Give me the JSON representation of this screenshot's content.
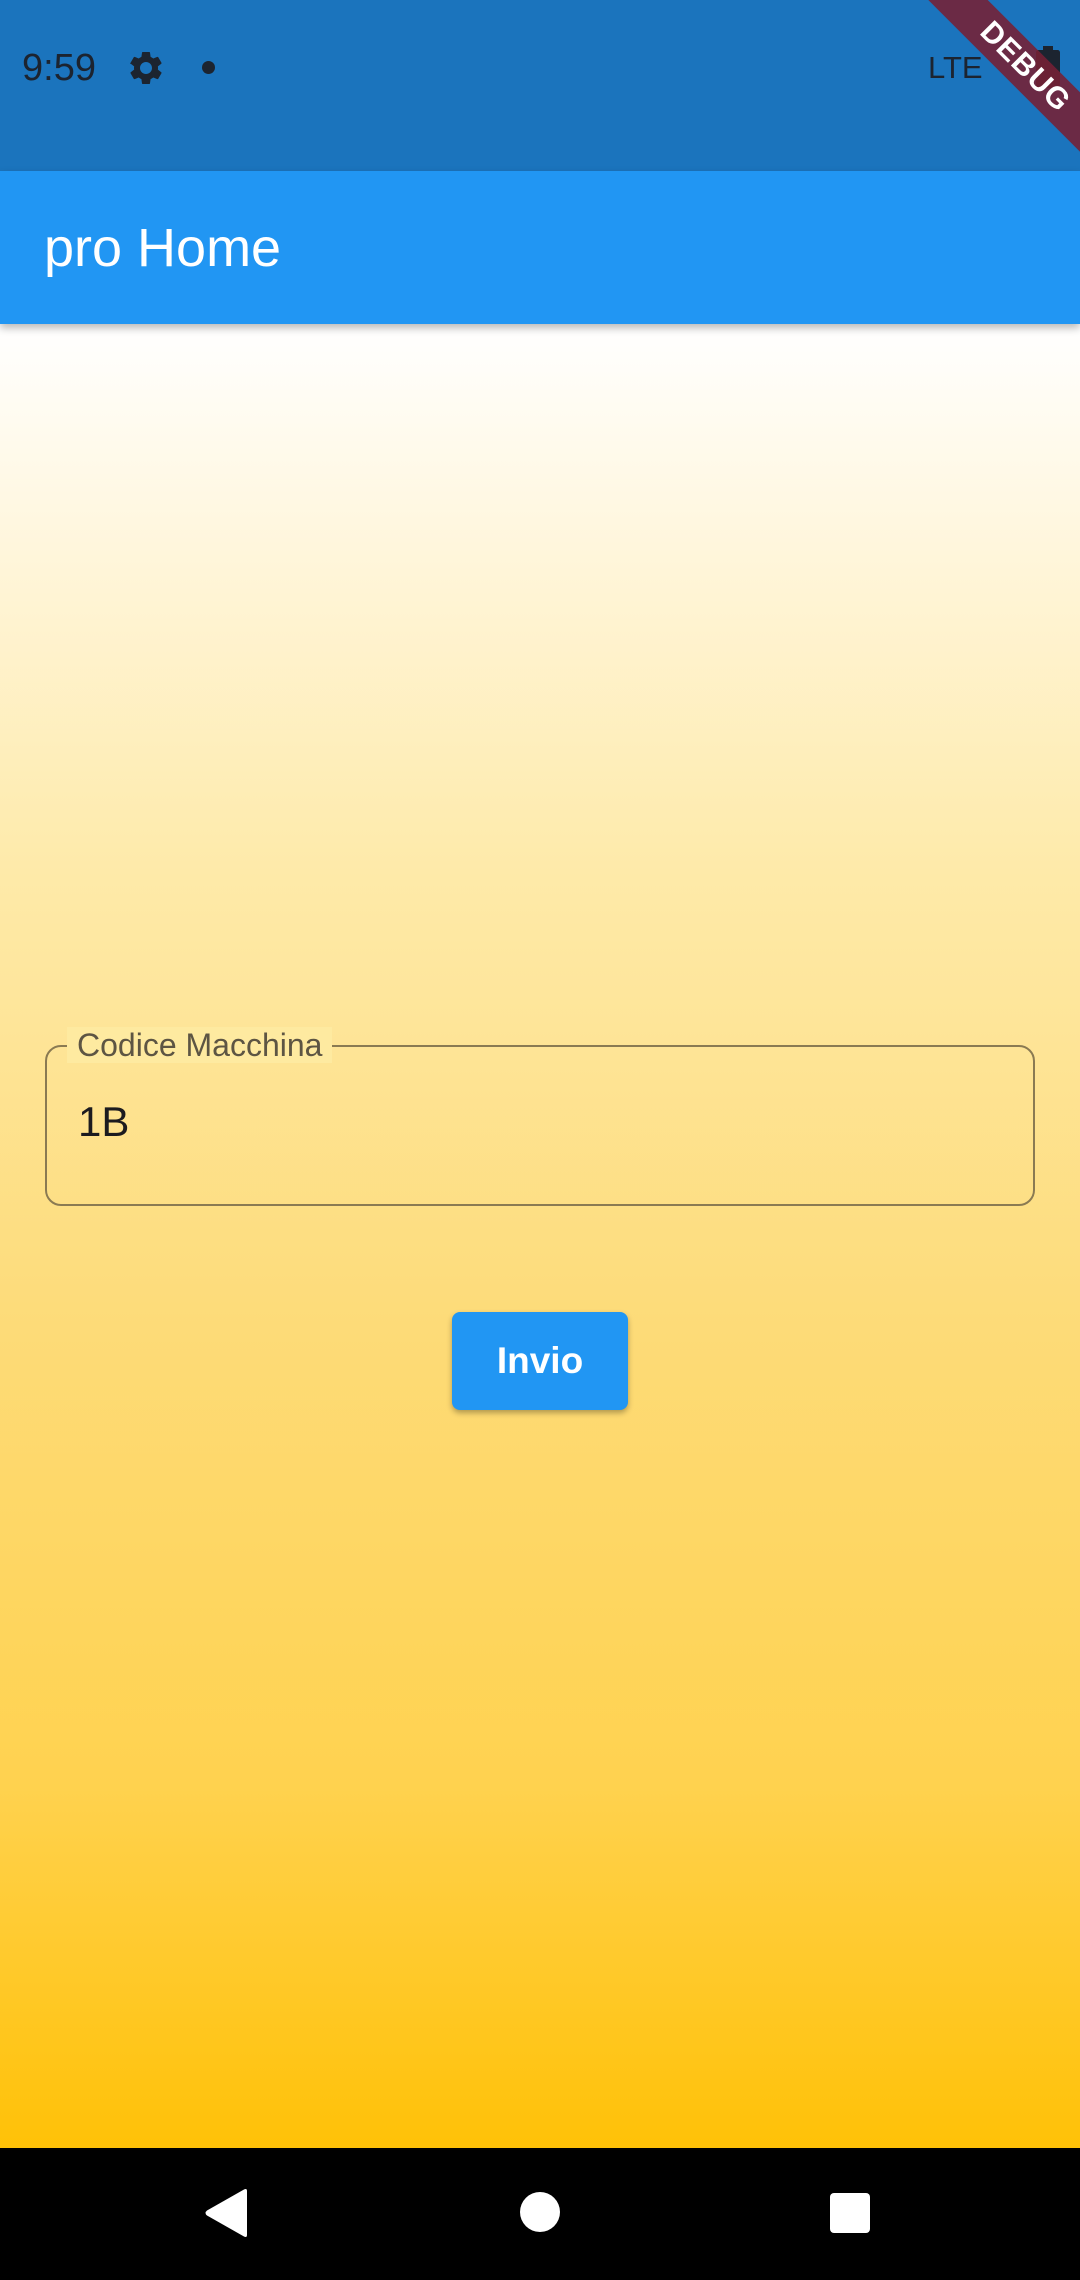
{
  "status_bar": {
    "time": "9:59",
    "network": "LTE",
    "icons": [
      "gear-icon",
      "notification-dot-icon",
      "battery-icon"
    ],
    "debug_label": "DEBUG"
  },
  "app_bar": {
    "title": "pro Home",
    "color": "#2196f3"
  },
  "form": {
    "machine_code_label": "Codice Macchina",
    "machine_code_value": "1B",
    "submit_label": "Invio"
  },
  "nav_bar": {
    "icons": [
      "back-icon",
      "home-icon",
      "recents-icon"
    ]
  },
  "colors": {
    "status_bar": "#1b74bd",
    "accent": "#2196f3",
    "gradient_top": "#ffffff",
    "gradient_bottom": "#ffc107"
  }
}
